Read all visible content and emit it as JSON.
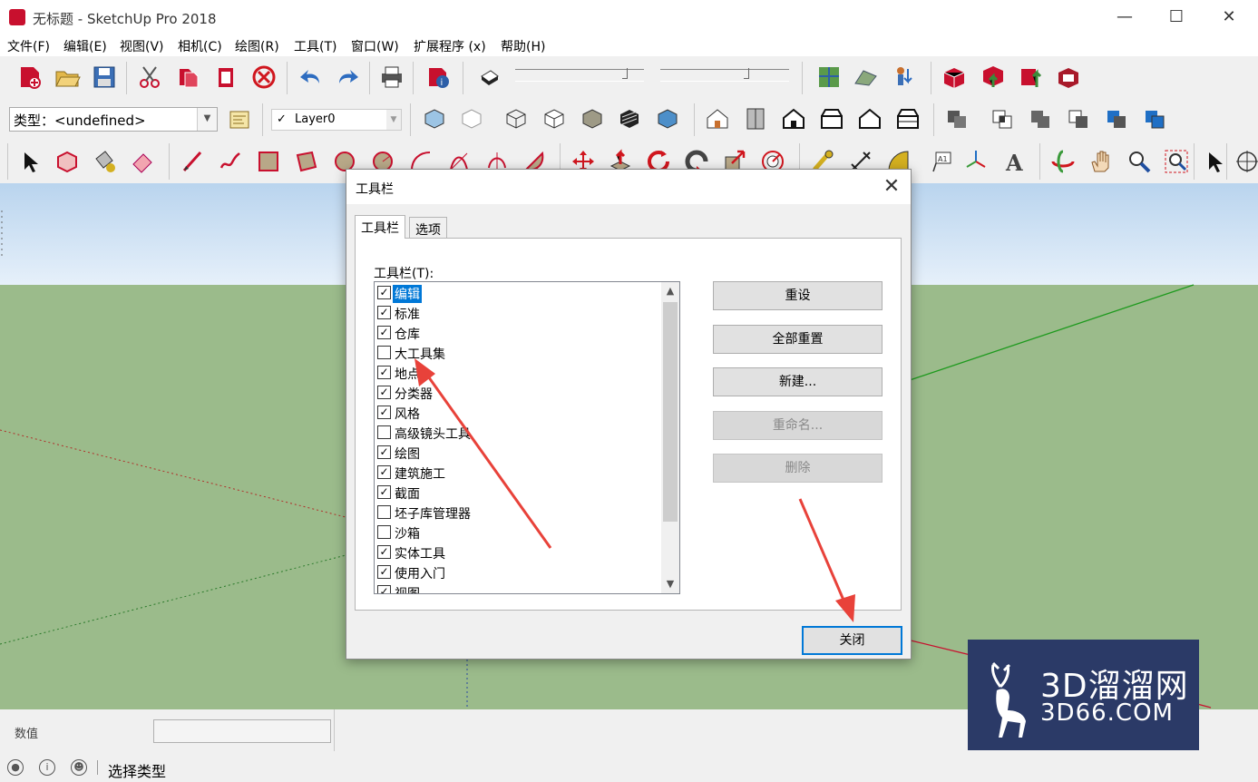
{
  "window": {
    "title": "无标题 - SketchUp Pro 2018",
    "minimize": "—",
    "maximize": "☐",
    "close": "✕"
  },
  "menu": [
    "文件(F)",
    "编辑(E)",
    "视图(V)",
    "相机(C)",
    "绘图(R)",
    "工具(T)",
    "窗口(W)",
    "扩展程序 (x)",
    "帮助(H)"
  ],
  "toolbar": {
    "type_label": "类型：<undefined>",
    "layer_check": "✓",
    "layer_value": "Layer0"
  },
  "dialog": {
    "title": "工具栏",
    "close_glyph": "✕",
    "tabs": [
      "工具栏",
      "选项"
    ],
    "list_label": "工具栏(T):",
    "items": [
      {
        "label": "编辑",
        "checked": true,
        "selected": true
      },
      {
        "label": "标准",
        "checked": true
      },
      {
        "label": "仓库",
        "checked": true
      },
      {
        "label": "大工具集",
        "checked": false
      },
      {
        "label": "地点",
        "checked": true
      },
      {
        "label": "分类器",
        "checked": true
      },
      {
        "label": "风格",
        "checked": true
      },
      {
        "label": "高级镜头工具",
        "checked": false
      },
      {
        "label": "绘图",
        "checked": true
      },
      {
        "label": "建筑施工",
        "checked": true
      },
      {
        "label": "截面",
        "checked": true
      },
      {
        "label": "坯子库管理器",
        "checked": false
      },
      {
        "label": "沙箱",
        "checked": false
      },
      {
        "label": "实体工具",
        "checked": true
      },
      {
        "label": "使用入门",
        "checked": true
      },
      {
        "label": "视图",
        "checked": true
      }
    ],
    "buttons": {
      "reset": "重设",
      "reset_all": "全部重置",
      "new": "新建...",
      "rename": "重命名...",
      "delete": "删除",
      "close": "关闭"
    }
  },
  "measurements": {
    "label": "数值",
    "value": ""
  },
  "status": {
    "text": "选择类型"
  },
  "watermark": {
    "line1": "3D溜溜网",
    "line2": "3D66.COM"
  },
  "colors": {
    "sky": "#c9def2",
    "ground": "#9bbb8b",
    "accent": "#0078d7",
    "annotation_arrow": "#e8423a",
    "brand": "#c8102e"
  }
}
